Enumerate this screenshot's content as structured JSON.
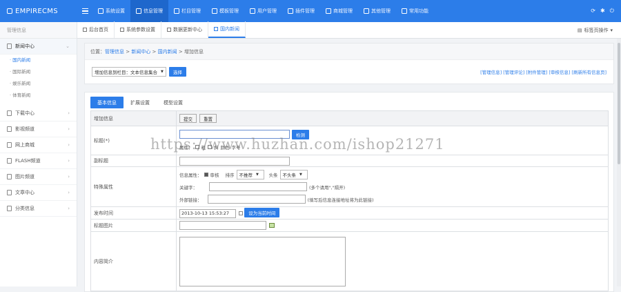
{
  "topbar": {
    "brand": "EMPIRECMS",
    "nav": [
      {
        "label": "系统设置",
        "icon": "gear-icon"
      },
      {
        "label": "信息管理",
        "icon": "edit-icon",
        "active": true
      },
      {
        "label": "栏目管理",
        "icon": "list-icon"
      },
      {
        "label": "模板管理",
        "icon": "layers-icon"
      },
      {
        "label": "用户管理",
        "icon": "user-icon"
      },
      {
        "label": "插件管理",
        "icon": "plugin-icon"
      },
      {
        "label": "商城管理",
        "icon": "cart-icon"
      },
      {
        "label": "其他管理",
        "icon": "wrench-icon"
      },
      {
        "label": "常用功能",
        "icon": "sliders-icon"
      }
    ],
    "right_icons": [
      "refresh-icon",
      "settings-icon",
      "power-icon"
    ]
  },
  "sidebar": {
    "header": "管理信息",
    "items": [
      {
        "label": "新闻中心",
        "open": true,
        "children": [
          {
            "label": "国内新闻",
            "active": true
          },
          {
            "label": "国际新闻"
          },
          {
            "label": "娱乐新闻"
          },
          {
            "label": "体育新闻"
          }
        ]
      },
      {
        "label": "下载中心"
      },
      {
        "label": "影视频道"
      },
      {
        "label": "网上商城"
      },
      {
        "label": "FLASH频道"
      },
      {
        "label": "图片频道"
      },
      {
        "label": "文章中心"
      },
      {
        "label": "分类信息"
      }
    ]
  },
  "tabs": {
    "items": [
      {
        "label": "后台首页"
      },
      {
        "label": "系统参数设置"
      },
      {
        "label": "数据更新中心"
      },
      {
        "label": "国内新闻",
        "active": true
      }
    ],
    "right_label": "标签页操作"
  },
  "crumb": {
    "prefix": "位置：",
    "links": [
      "管理信息",
      "新闻中心",
      "国内新闻"
    ],
    "sep": " > ",
    "current": "增加信息"
  },
  "toolbar": {
    "select_value": "增加信息到栏目：文本信息集合",
    "select_button": "选择",
    "links": [
      "[管理信息]",
      "[管理评论]",
      "[附件管理]",
      "[审核信息]",
      "[刷新所有信息页]"
    ]
  },
  "form": {
    "tabs": [
      {
        "label": "基本信息",
        "active": true
      },
      {
        "label": "扩展设置"
      },
      {
        "label": "模型设置"
      }
    ],
    "head_label": "增加信息",
    "submit_label": "提交",
    "reset_label": "重置",
    "title_label": "标题(*)",
    "title_btn": "检测",
    "title_opts": [
      "属性：",
      "粗",
      "斜",
      "颜色",
      "字号"
    ],
    "subtitle_label": "副标题",
    "special_label": "特殊属性",
    "status_label": "信息属性：",
    "review": "审核",
    "order_label": "排序",
    "order_value": "不推荐",
    "head_opt_label": "头条",
    "head_opt_value": "不头条",
    "keywords_label": "关键字：",
    "keywords_hint": "(多个请用\",\"隔开)",
    "link_label": "外部链接：",
    "link_hint": "(填写后信息连接地址将为此链接)",
    "date_label": "发布时间",
    "date_value": "2013-10-13 15:53:27",
    "date_btn": "设为当前时间",
    "pic_label": "标题图片",
    "intro_label": "内容简介"
  },
  "watermark": "https://www.huzhan.com/ishop21271"
}
